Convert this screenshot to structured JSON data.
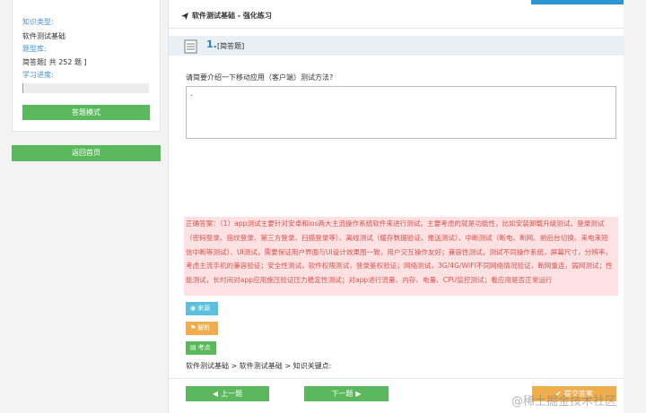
{
  "sidebar": {
    "knowledge_type_label": "知识类型:",
    "knowledge_type_value": "软件测试基础",
    "question_type_label": "题型库:",
    "question_type_value": "简答题[ 共 252 题 ]",
    "progress_label": "学习进度:",
    "progress": 0,
    "mode_button": "答题模式",
    "home_button": "返回首页"
  },
  "main": {
    "page_title": "软件测试基础 - 强化练习",
    "question_number": "1.",
    "question_type": "[简答题]",
    "question_text": "请简要介绍一下移动应用（客户端）测试方法?",
    "answer_value": ".",
    "correct_answer": "正确答案：（1）app测试主要针对安卓和ios两大主流操作系统软件来进行测试。主要考虑的就是功能性，比如安装卸载升级测试、登录测试（密码登录、指纹登录、第三方登录、扫描登录等）、离线测试（缓存数据验证、推送测试）、中断测试（断电、断网、前后台切换、来电来短信中断等测试）、UI测试，需要保证用户界面与UI设计效果图一致，用户交互操作友好；兼容性测试，测试不同操作系统，屏幕尺寸，分辨率，考虑主流手机的兼容验证；安全性测试，软件权限测试，登录鉴权验证；网络测试，3G/4G/WIFI不同网络情况验证，断网重连，弱网测试；性能测试，长时间对app应用施压验证压力稳定性测试；对app进行流量、内存、电量、CPU监控测试；看应用是否正常运行",
    "tags": {
      "source": "来源",
      "analysis": "解析",
      "point": "考点"
    },
    "breadcrumb": "软件测试基础 > 软件测试基础 > 知识关键点:",
    "prev_button": "上一题",
    "next_button": "下一题",
    "submit_button": "提交答案"
  },
  "watermark": "@稀土掘金技术社区",
  "icons": {
    "title": "paper-plane-icon",
    "question": "document-icon",
    "source": "eye-icon",
    "analysis": "flag-icon",
    "point": "book-icon",
    "prev": "chevron-left-circle-icon",
    "next": "chevron-right-circle-icon",
    "submit": "check-circle-icon"
  },
  "colors": {
    "green": "#5cb85c",
    "blue_label": "#4a90c8",
    "answer_bg": "#fde1e3",
    "answer_text": "#d9534f",
    "info": "#5bc0de",
    "warning": "#f0ad4e"
  }
}
